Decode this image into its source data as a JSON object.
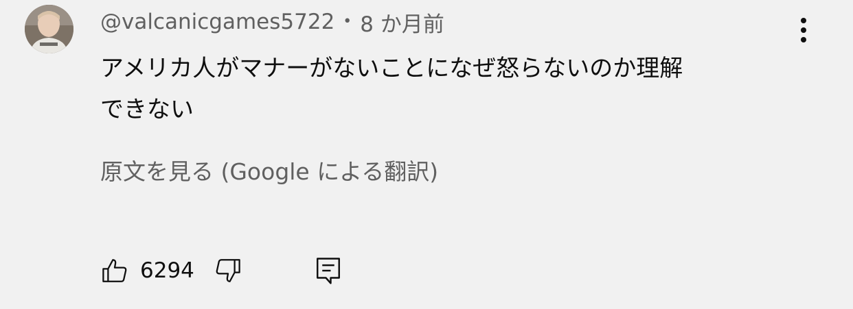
{
  "comment": {
    "author": "@valcanicgames5722",
    "separator": "•",
    "time_ago": "8 か月前",
    "text_line1": "アメリカ人がマナーがないことになぜ怒らないのか理解",
    "text_line2": "できない",
    "translate_label": "原文を見る (Google による翻訳)",
    "like_count": "6294"
  },
  "icons": {
    "menu": "more-vertical-icon",
    "like": "thumbs-up-icon",
    "dislike": "thumbs-down-icon",
    "reply": "comment-reply-icon"
  },
  "colors": {
    "background": "#f1f1f1",
    "primary_text": "#0f0f0f",
    "secondary_text": "#606060"
  }
}
